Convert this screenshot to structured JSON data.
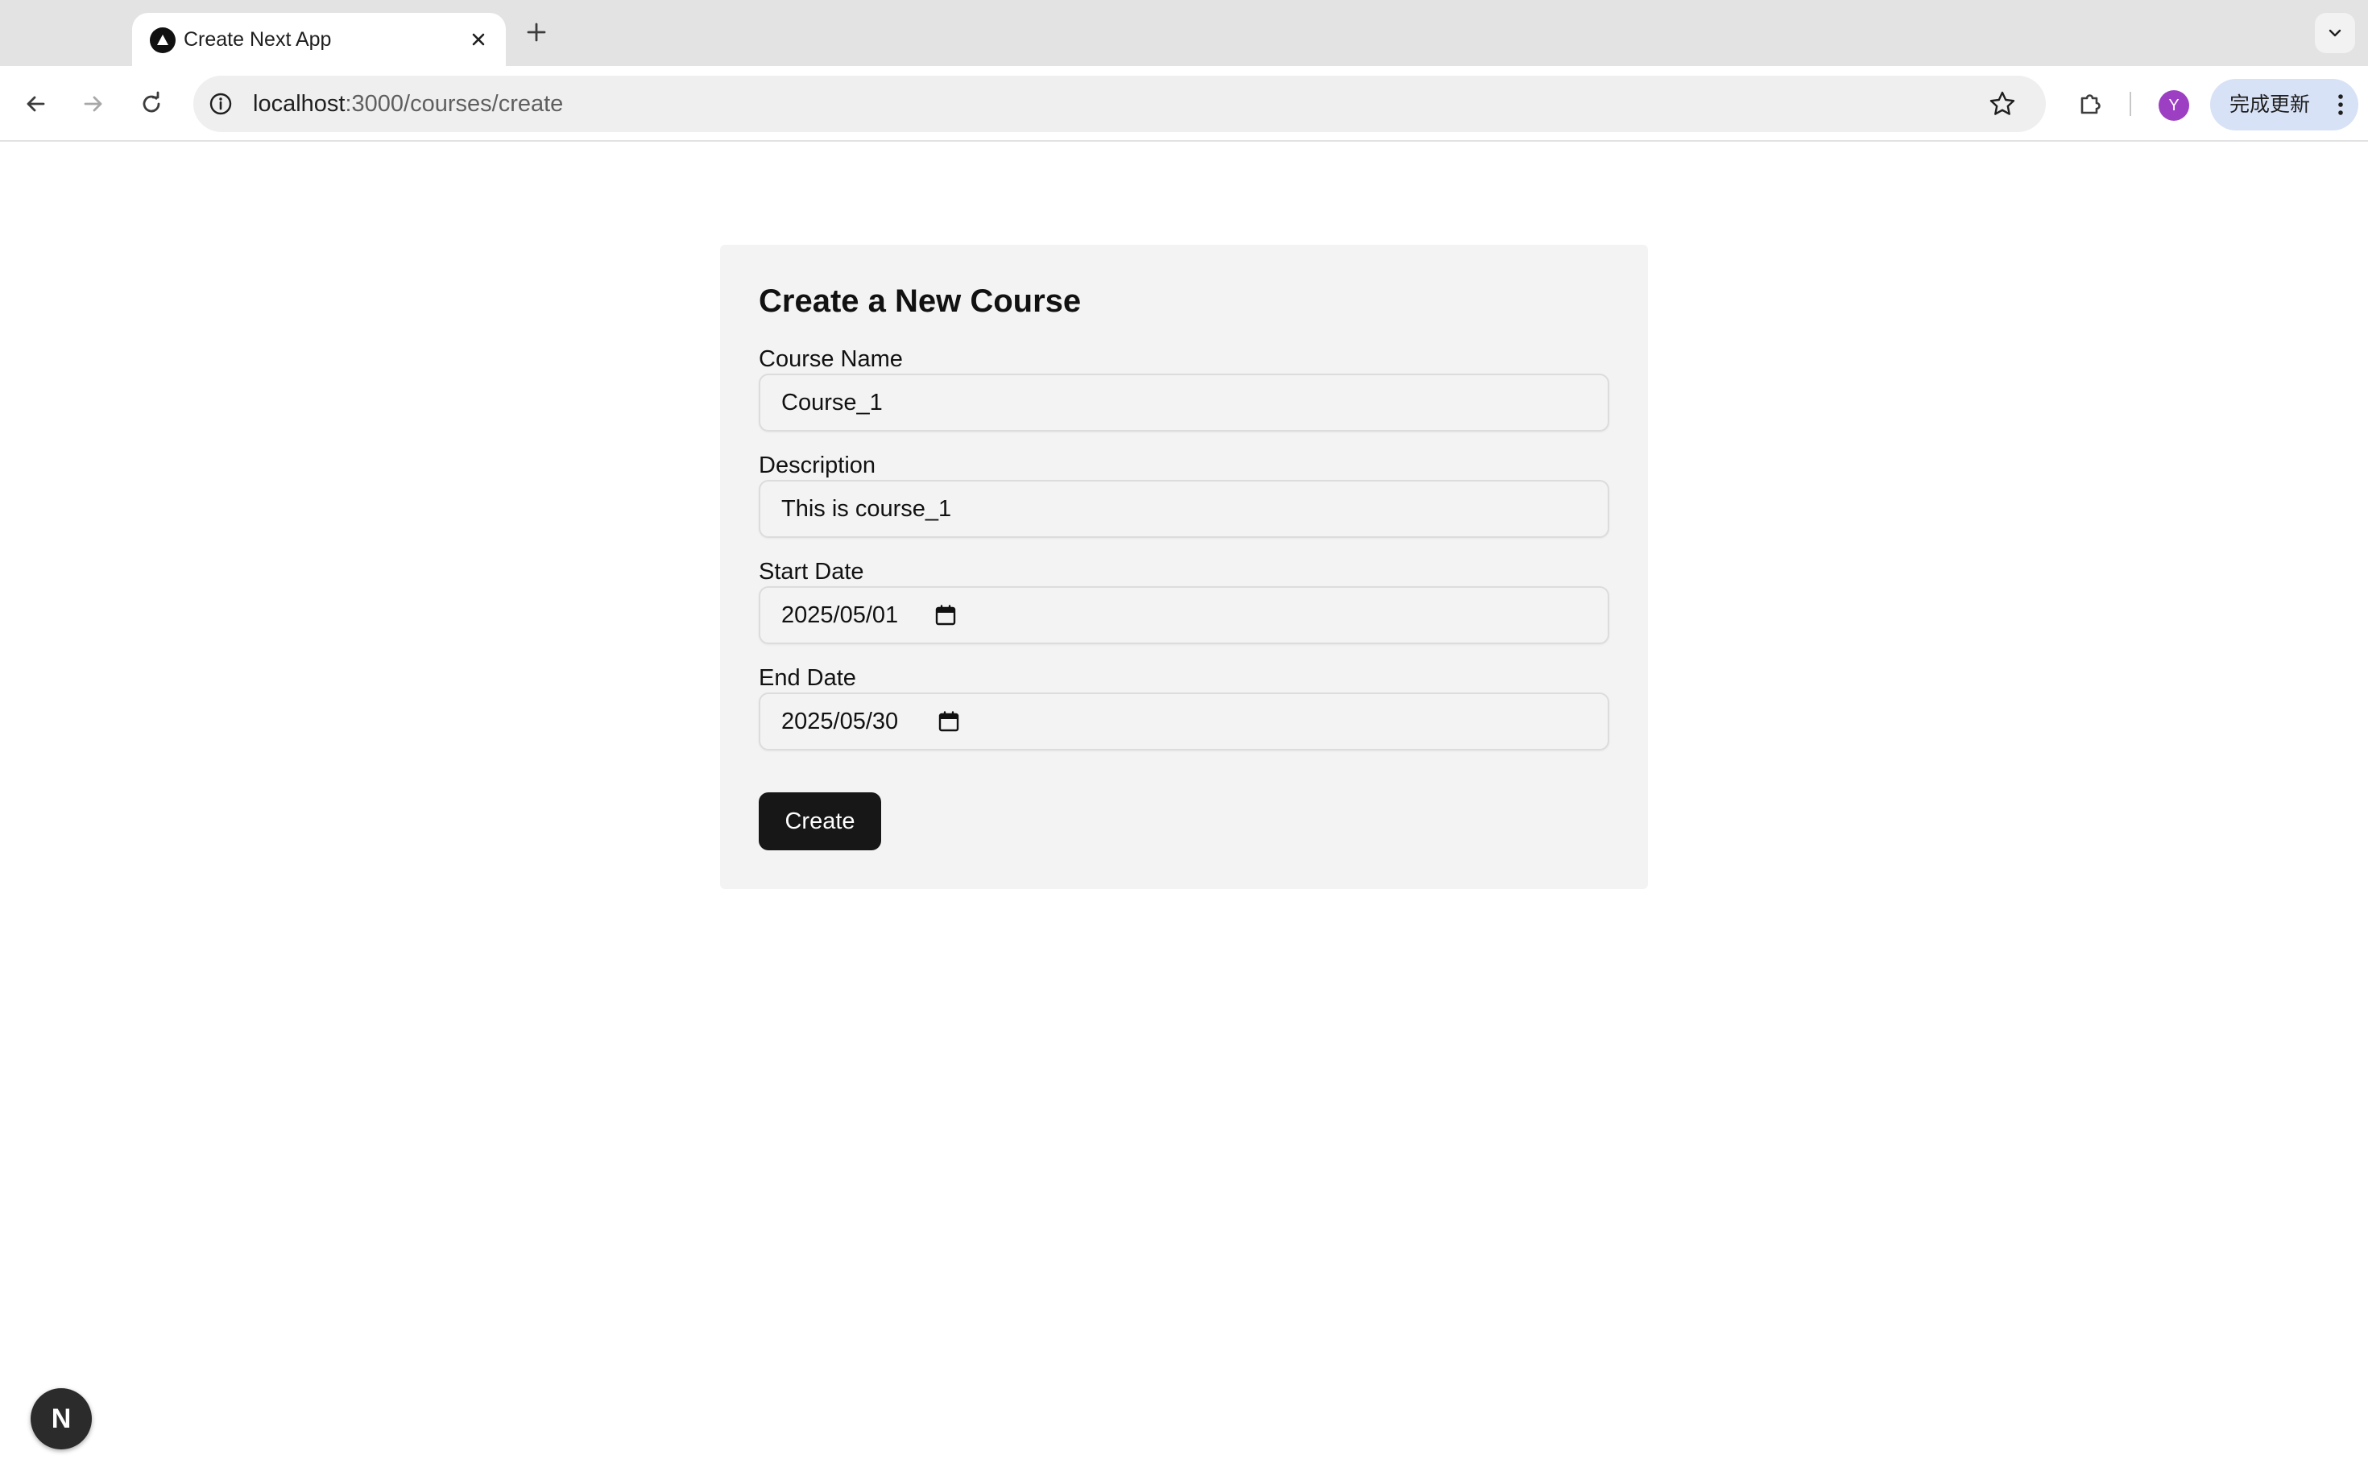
{
  "browser": {
    "tab": {
      "title": "Create Next App",
      "favicon": "nextjs-triangle-icon"
    },
    "url": {
      "host": "localhost",
      "path": ":3000/courses/create"
    },
    "profile_initial": "Y",
    "profile_color": "#9c3fc2",
    "update_label": "完成更新",
    "icons": {
      "back": "arrow-left-icon",
      "forward": "arrow-right-icon",
      "reload": "reload-icon",
      "site_info": "info-circle-icon",
      "bookmark": "star-outline-icon",
      "extensions": "puzzle-icon",
      "menu": "three-dots-vertical-icon",
      "new_tab": "plus-icon",
      "tab_search": "chevron-down-icon",
      "close_tab": "close-icon"
    }
  },
  "form": {
    "title": "Create a New Course",
    "fields": {
      "course_name": {
        "label": "Course Name",
        "value": "Course_1"
      },
      "description": {
        "label": "Description",
        "value": "This is course_1"
      },
      "start_date": {
        "label": "Start Date",
        "value": "2025/05/01"
      },
      "end_date": {
        "label": "End Date",
        "value": "2025/05/30"
      }
    },
    "submit_label": "Create",
    "button_color": "#171717",
    "card_color": "#f3f3f3"
  },
  "dev_badge": {
    "label": "N"
  }
}
